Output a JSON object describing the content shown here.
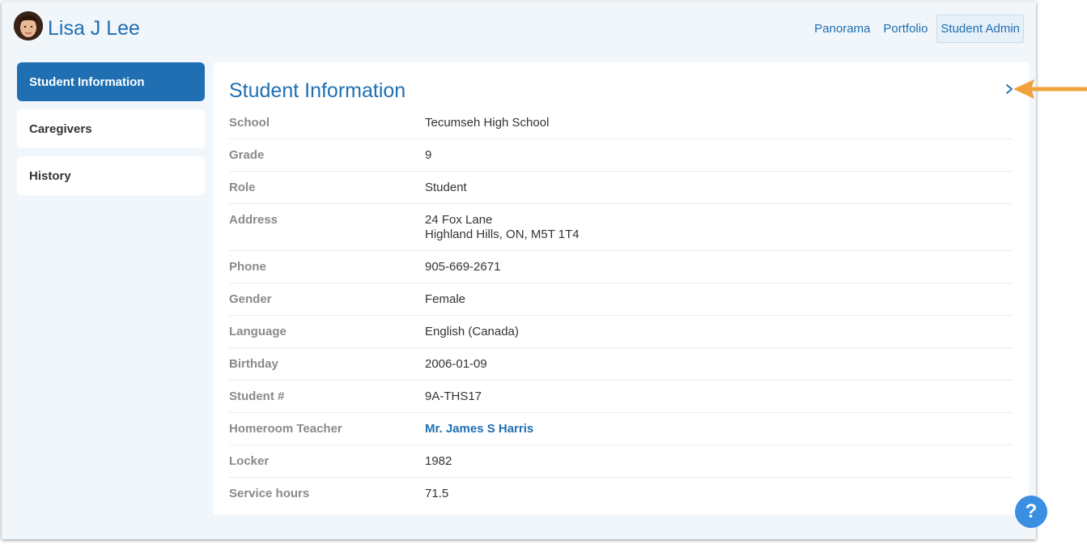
{
  "header": {
    "student_name": "Lisa J Lee",
    "nav": [
      {
        "label": "Panorama",
        "active": false
      },
      {
        "label": "Portfolio",
        "active": false
      },
      {
        "label": "Student Admin",
        "active": true
      }
    ]
  },
  "sidebar": {
    "items": [
      {
        "label": "Student Information",
        "active": true
      },
      {
        "label": "Caregivers",
        "active": false
      },
      {
        "label": "History",
        "active": false
      }
    ]
  },
  "panel": {
    "title": "Student Information",
    "rows": [
      {
        "label": "School",
        "value": "Tecumseh High School"
      },
      {
        "label": "Grade",
        "value": "9"
      },
      {
        "label": "Role",
        "value": "Student"
      },
      {
        "label": "Address",
        "value_line1": "24 Fox Lane",
        "value_line2": "Highland Hills, ON, M5T 1T4"
      },
      {
        "label": "Phone",
        "value": "905-669-2671"
      },
      {
        "label": "Gender",
        "value": "Female"
      },
      {
        "label": "Language",
        "value": "English (Canada)"
      },
      {
        "label": "Birthday",
        "value": "2006-01-09"
      },
      {
        "label": "Student #",
        "value": "9A-THS17"
      },
      {
        "label": "Homeroom Teacher",
        "value": "Mr. James S Harris"
      },
      {
        "label": "Locker",
        "value": "1982"
      },
      {
        "label": "Service hours",
        "value": "71.5"
      }
    ]
  },
  "help": {
    "label": "?"
  },
  "icons": {
    "avatar": "student-avatar",
    "panel_chevron": "chevron-right-icon",
    "annotation": "arrow-left-icon"
  },
  "colors": {
    "accent": "#1f6fb2",
    "background": "#f1f6fa",
    "annotation_arrow": "#f0a23b",
    "help_button": "#3b8fe3"
  }
}
